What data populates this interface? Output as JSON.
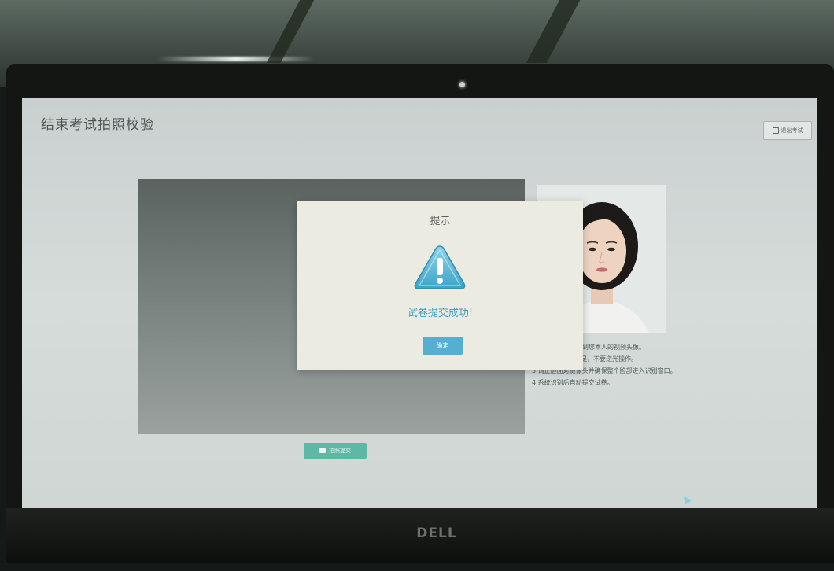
{
  "page": {
    "title": "结束考试拍照校验",
    "exit_button": "退出考试"
  },
  "instructions": [
    "窗口中应清晰的看到您本人的视频头像。",
    "光充足，不要逆光操作。",
    "3.请正脸面对摄像头并确保整个脸部进入识别窗口。",
    "4.系统识别后自动提交试卷。"
  ],
  "capture_button": "拍照提交",
  "dialog": {
    "title": "提示",
    "message": "试卷提交成功!",
    "ok_label": "确定"
  },
  "monitor": {
    "brand": "DELL"
  },
  "icons": {
    "exit": "exit-icon",
    "camera": "camera-icon",
    "warning": "warning-triangle-icon"
  },
  "colors": {
    "accent_blue": "#56afd0",
    "button_green": "#5fb8a3",
    "dialog_bg": "#ecebe1"
  }
}
